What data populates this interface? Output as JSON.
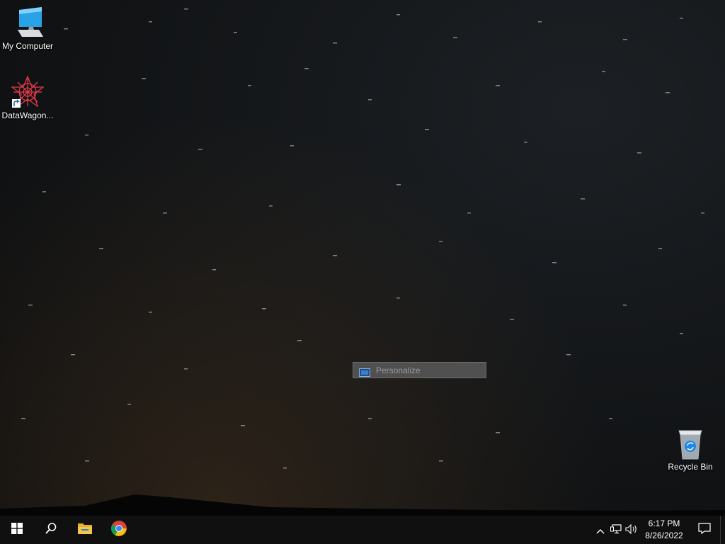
{
  "desktop": {
    "icons": [
      {
        "label": "My Computer",
        "icon": "computer-icon"
      },
      {
        "label": "DataWagon...",
        "icon": "datawagon-icon"
      },
      {
        "label": "Recycle Bin",
        "icon": "recycle-bin-icon"
      }
    ]
  },
  "context_menu": {
    "items": [
      {
        "label": "Personalize",
        "icon": "display-icon"
      }
    ]
  },
  "taskbar": {
    "start": "windows-start-icon",
    "search": "search-icon",
    "pinned": [
      "file-explorer-icon",
      "chrome-icon"
    ],
    "tray": {
      "icons": [
        "chevron-up-icon",
        "network-icon",
        "volume-icon"
      ],
      "time": "6:17 PM",
      "date": "8/26/2022",
      "notification": "notification-icon"
    }
  },
  "colors": {
    "taskbar": "#101010",
    "menu_bg": "#505050",
    "accent_blue": "#29a3e6"
  }
}
